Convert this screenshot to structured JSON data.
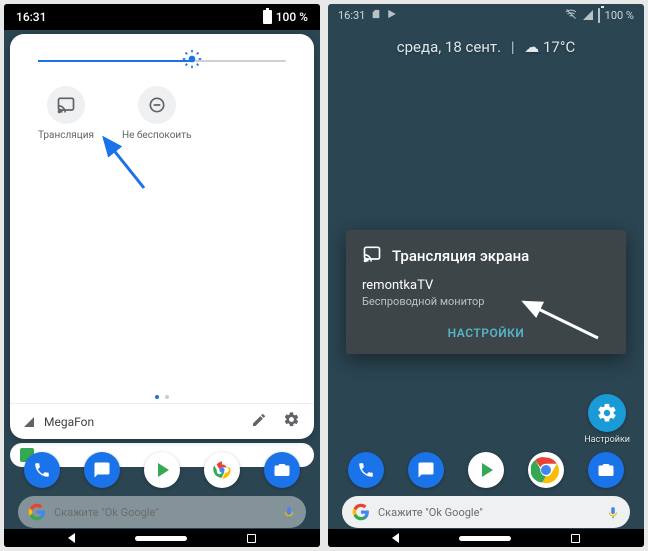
{
  "left": {
    "status": {
      "time": "16:31",
      "battery": "100 %"
    },
    "qs": {
      "tiles": [
        {
          "label": "Трансляция"
        },
        {
          "label": "Не беспокоить"
        }
      ],
      "carrier": "MegaFon"
    },
    "search_hint": "Скажите \"Ok Google\""
  },
  "right": {
    "status": {
      "time": "16:31",
      "battery": "100 %"
    },
    "date": {
      "day": "среда, 18 сент.",
      "weather": "17°C"
    },
    "dialog": {
      "title": "Трансляция экрана",
      "device": "remontkaTV",
      "subtitle": "Беспроводной монитор",
      "button": "НАСТРОЙКИ"
    },
    "shortcut_label": "Настройки",
    "search_hint": "Скажите \"Ok Google\""
  }
}
